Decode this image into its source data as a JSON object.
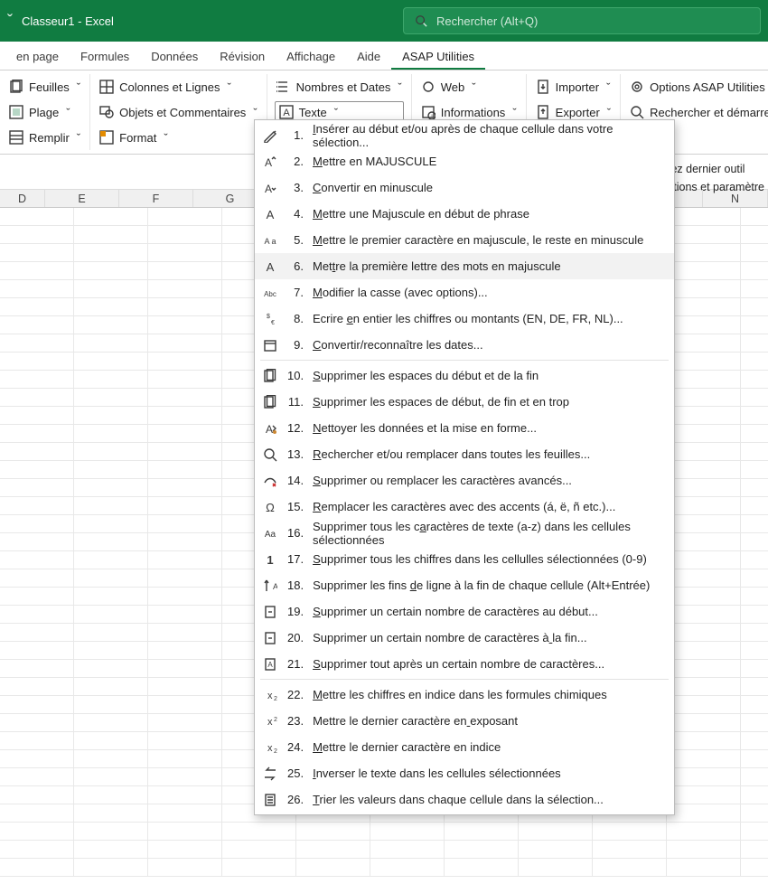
{
  "titlebar": {
    "title": "Classeur1  -  Excel"
  },
  "search": {
    "placeholder": "Rechercher (Alt+Q)"
  },
  "tabs": {
    "items": [
      {
        "label": "en page"
      },
      {
        "label": "Formules"
      },
      {
        "label": "Données"
      },
      {
        "label": "Révision"
      },
      {
        "label": "Affichage"
      },
      {
        "label": "Aide"
      },
      {
        "label": "ASAP Utilities"
      }
    ],
    "active_index": 6
  },
  "ribbon": {
    "g0": {
      "r0": "Feuilles",
      "r1": "Plage",
      "r2": "Remplir"
    },
    "g1": {
      "r0": "Colonnes et Lignes",
      "r1": "Objets et Commentaires",
      "r2": "Format"
    },
    "g2": {
      "r0": "Nombres et Dates",
      "r1": "Texte"
    },
    "g3": {
      "r0": "Web",
      "r1": "Informations"
    },
    "g4": {
      "r0": "Importer",
      "r1": "Exporter"
    },
    "g5": {
      "r0": "Options ASAP Utilities",
      "r1": "Rechercher et démarrer un"
    }
  },
  "right_cut": {
    "l0": "rez dernier outil",
    "l1": "ptions et paramètre"
  },
  "columns": [
    "D",
    "E",
    "F",
    "G",
    "",
    "",
    "",
    "",
    "",
    "N"
  ],
  "menu": {
    "items": [
      {
        "num": "1.",
        "label": "Insérer au début et/ou après de chaque cellule dans votre sélection...",
        "u": 0
      },
      {
        "num": "2.",
        "label": "Mettre en MAJUSCULE",
        "u": 0
      },
      {
        "num": "3.",
        "label": "Convertir en minuscule",
        "u": 0
      },
      {
        "num": "4.",
        "label": "Mettre une Majuscule en début de phrase",
        "u": 0
      },
      {
        "num": "5.",
        "label": "Mettre le premier caractère en majuscule, le reste en minuscule",
        "u": 0
      },
      {
        "num": "6.",
        "label": "Mettre la première lettre des mots en majuscule",
        "u": 3,
        "hover": true
      },
      {
        "num": "7.",
        "label": "Modifier la casse (avec options)...",
        "u": 0
      },
      {
        "num": "8.",
        "label": "Ecrire en entier les chiffres ou montants (EN, DE, FR, NL)...",
        "u": 7
      },
      {
        "num": "9.",
        "label": "Convertir/reconnaître les dates...",
        "u": 0
      },
      {
        "num": "10.",
        "label": "Supprimer les espaces du début et de la fin",
        "u": 0
      },
      {
        "num": "11.",
        "label": "Supprimer les espaces de début, de fin et en trop",
        "u": 0
      },
      {
        "num": "12.",
        "label": "Nettoyer les données et la mise en forme...",
        "u": 0
      },
      {
        "num": "13.",
        "label": "Rechercher et/ou remplacer dans toutes les feuilles...",
        "u": 0
      },
      {
        "num": "14.",
        "label": "Supprimer ou remplacer les caractères avancés...",
        "u": 0
      },
      {
        "num": "15.",
        "label": "Remplacer les caractères avec des accents (á, ë, ñ etc.)...",
        "u": 0
      },
      {
        "num": "16.",
        "label": "Supprimer tous les caractères de texte (a-z) dans les cellules sélectionnées",
        "u": 20
      },
      {
        "num": "17.",
        "label": "Supprimer tous les chiffres dans les cellulles sélectionnées (0-9)",
        "u": 0
      },
      {
        "num": "18.",
        "label": "Supprimer les fins de ligne à la fin de chaque cellule (Alt+Entrée)",
        "u": 19
      },
      {
        "num": "19.",
        "label": "Supprimer un certain nombre de caractères au début...",
        "u": 0
      },
      {
        "num": "20.",
        "label": "Supprimer un certain nombre de caractères à la fin...",
        "u": 43
      },
      {
        "num": "21.",
        "label": "Supprimer tout après un certain nombre de caractères...",
        "u": 0
      },
      {
        "num": "22.",
        "label": "Mettre les chiffres en indice dans les formules chimiques",
        "u": 0
      },
      {
        "num": "23.",
        "label": "Mettre le dernier caractère en exposant",
        "u": 30
      },
      {
        "num": "24.",
        "label": "Mettre le dernier caractère en indice",
        "u": 0
      },
      {
        "num": "25.",
        "label": "Inverser le texte dans les cellules sélectionnées",
        "u": 0
      },
      {
        "num": "26.",
        "label": "Trier les valeurs dans chaque cellule dans la sélection...",
        "u": 0
      }
    ]
  }
}
